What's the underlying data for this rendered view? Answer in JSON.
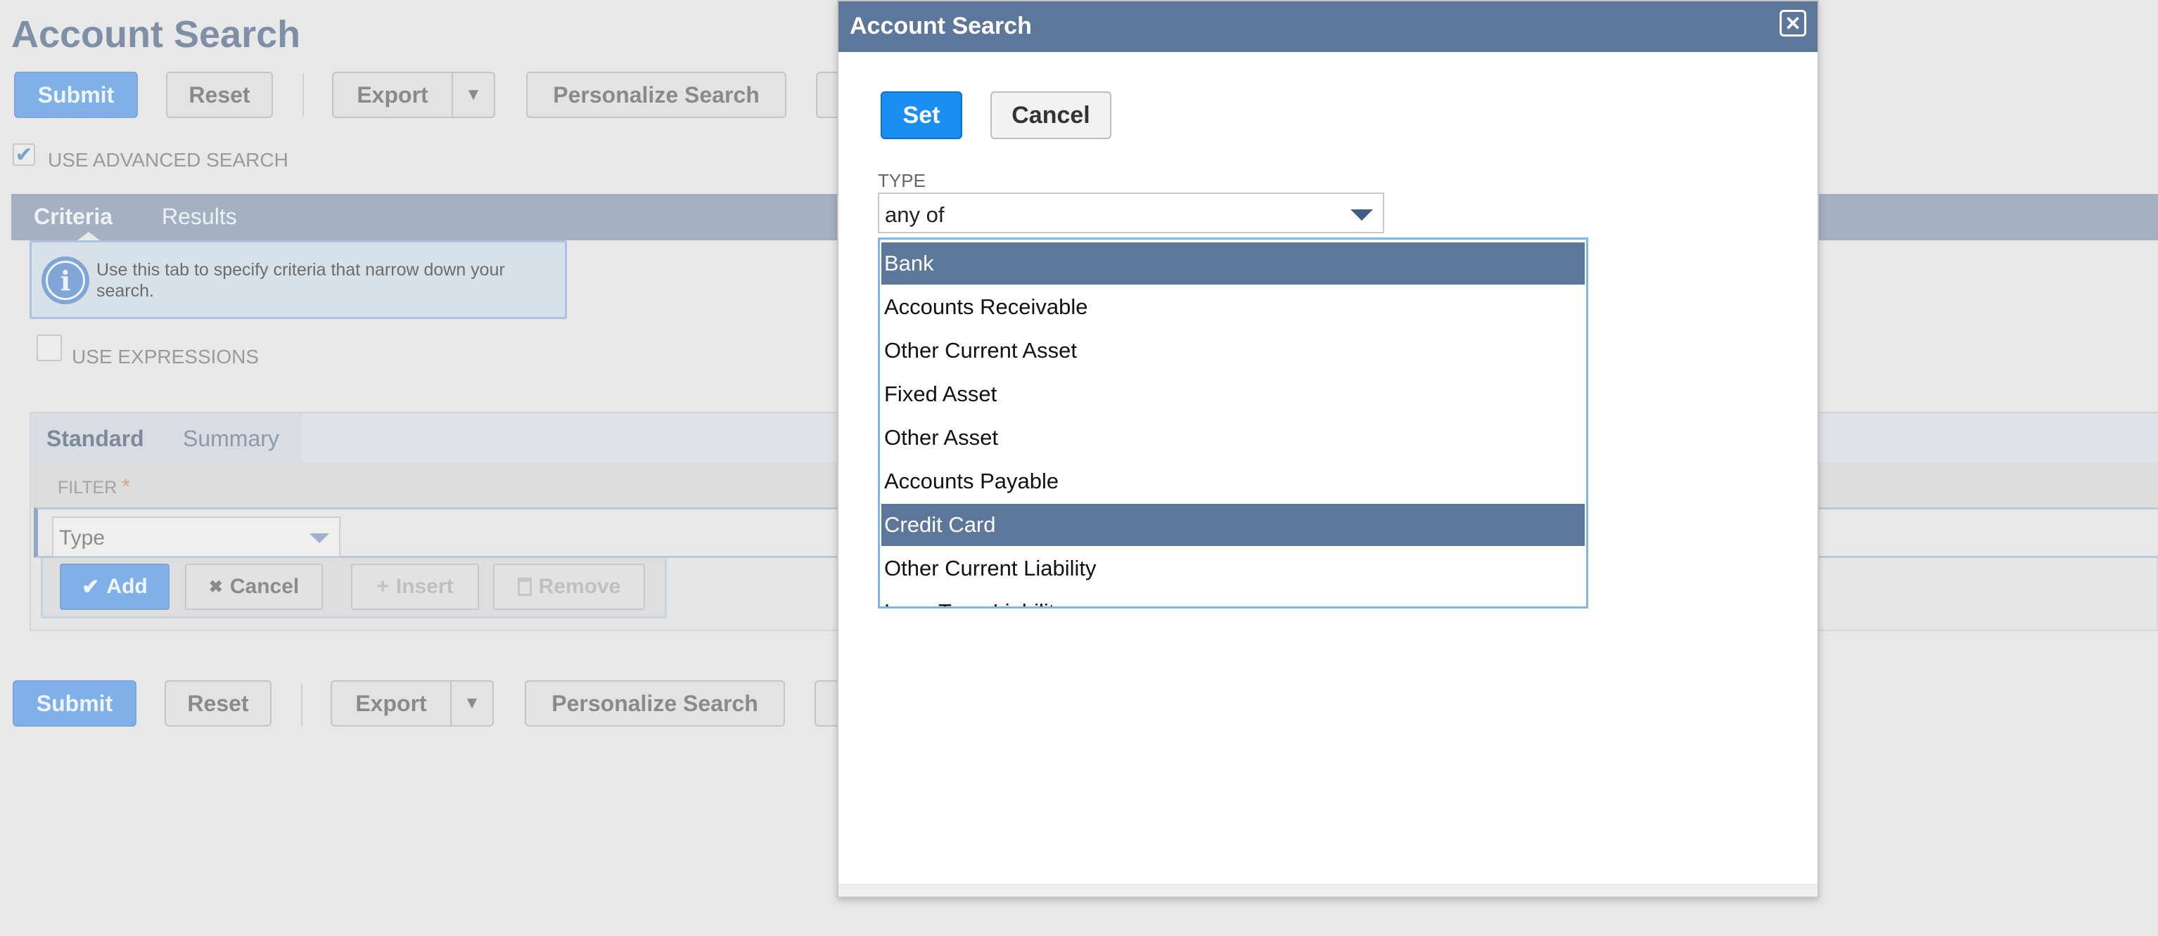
{
  "page": {
    "title": "Account Search",
    "top_buttons": {
      "submit": "Submit",
      "reset": "Reset",
      "export": "Export",
      "export_menu_icon": "▼",
      "personalize": "Personalize Search"
    },
    "use_advanced_search": "USE ADVANCED SEARCH",
    "tabs": {
      "criteria": "Criteria",
      "results": "Results"
    },
    "info_text": "Use this tab to specify criteria that narrow down your search.",
    "use_expressions": "USE EXPRESSIONS",
    "sub_tabs": {
      "standard": "Standard",
      "summary": "Summary"
    },
    "filter_label": "FILTER",
    "filter_required_mark": "*",
    "filter_type_value": "Type",
    "actions": {
      "add": "Add",
      "cancel": "Cancel",
      "insert": "Insert",
      "remove": "Remove"
    },
    "bottom_buttons": {
      "submit": "Submit",
      "reset": "Reset",
      "export": "Export",
      "export_menu_icon": "▼",
      "personalize": "Personalize Search"
    }
  },
  "modal": {
    "title": "Account Search",
    "close_icon": "✕",
    "set_label": "Set",
    "cancel_label": "Cancel",
    "field_label": "TYPE",
    "operator_value": "any of",
    "options": [
      {
        "label": "Bank",
        "selected": true
      },
      {
        "label": "Accounts Receivable",
        "selected": false
      },
      {
        "label": "Other Current Asset",
        "selected": false
      },
      {
        "label": "Fixed Asset",
        "selected": false
      },
      {
        "label": "Other Asset",
        "selected": false
      },
      {
        "label": "Accounts Payable",
        "selected": false
      },
      {
        "label": "Credit Card",
        "selected": true
      },
      {
        "label": "Other Current Liability",
        "selected": false
      },
      {
        "label": "Long Term Liability",
        "selected": false
      }
    ]
  },
  "colors": {
    "modal_header": "#5c7799",
    "selected_option": "#5c7799",
    "set_button": "#1a8ef2",
    "list_border": "#7eb6ec"
  },
  "icons": {
    "check": "✔",
    "info": "i",
    "add": "✔",
    "cancel": "✖",
    "insert": "+",
    "remove": "🗑"
  }
}
